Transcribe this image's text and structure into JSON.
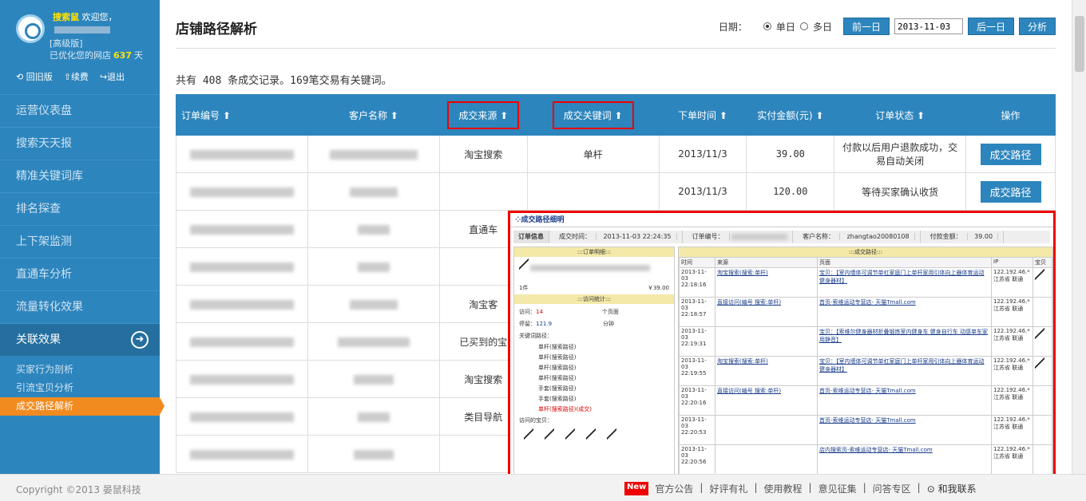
{
  "sidebar": {
    "username": "搜索鼠",
    "welcome": "欢迎您，",
    "edition": "[高级版]",
    "optimized_prefix": "已优化您的网店",
    "optimized_days": "637",
    "days_unit": "天",
    "links": [
      "回旧版",
      "续费",
      "退出"
    ],
    "items": [
      "运营仪表盘",
      "搜索天天报",
      "精准关键词库",
      "排名探查",
      "上下架监测",
      "直通车分析",
      "流量转化效果",
      "关联效果"
    ],
    "subitems": [
      "买家行为剖析",
      "引流宝贝分析",
      "成交路径解析"
    ]
  },
  "header": {
    "title": "店铺路径解析",
    "date_label": "日期：",
    "single_day": "单日",
    "multi_day": "多日",
    "prev_day": "前一日",
    "date_value": "2013-11-03",
    "next_day": "后一日",
    "analyze": "分析"
  },
  "summary": "共有 408 条成交记录。169笔交易有关键词。",
  "table": {
    "headers": [
      "订单编号",
      "客户名称",
      "成交来源",
      "成交关键词",
      "下单时间",
      "实付金额(元)",
      "订单状态",
      "操作"
    ],
    "rows": [
      {
        "source": "淘宝搜索",
        "keyword": "单杆",
        "time": "2013/11/3",
        "amount": "39.00",
        "status": "付款以后用户退款成功，交易自动关闭",
        "op": "成交路径"
      },
      {
        "source": "",
        "keyword": "",
        "time": "2013/11/3",
        "amount": "120.00",
        "status": "等待买家确认收货",
        "op": "成交路径"
      },
      {
        "source": "直通车",
        "keyword": "",
        "time": "",
        "amount": "",
        "status": "",
        "op": ""
      },
      {
        "source": "",
        "keyword": "",
        "time": "",
        "amount": "",
        "status": "",
        "op": ""
      },
      {
        "source": "淘宝客",
        "keyword": "",
        "time": "",
        "amount": "",
        "status": "",
        "op": ""
      },
      {
        "source": "已买到的宝",
        "keyword": "",
        "time": "",
        "amount": "",
        "status": "",
        "op": ""
      },
      {
        "source": "淘宝搜索",
        "keyword": "",
        "time": "",
        "amount": "",
        "status": "",
        "op": ""
      },
      {
        "source": "类目导航",
        "keyword": "",
        "time": "",
        "amount": "",
        "status": "",
        "op": ""
      },
      {
        "source": "",
        "keyword": "",
        "time": "",
        "amount": "",
        "status": "",
        "op": ""
      }
    ]
  },
  "overlay": {
    "title": "成交路径细明",
    "order_info": "订单信息",
    "deal_time_label": "成交时间：",
    "deal_time": "2013-11-03 22:24:35",
    "order_no_label": "订单编号：",
    "customer_label": "客户名称：",
    "customer": "zhangtao20080108",
    "paid_label": "付款金额：",
    "paid": "39.00",
    "detail_header": ":::订单明细:::",
    "qty": "1件",
    "price": "￥39.00",
    "visit_header": ":::访问统计:::",
    "visit_label": "访问：",
    "visit_count": "14",
    "visit_unit": "个页面",
    "stay_label": "停留：",
    "stay_value": "121.9",
    "stay_unit": "分钟",
    "keyword_path_label": "关键词路径：",
    "paths": [
      "单杆(搜索路径)",
      "单杆(搜索路径)",
      "单杆(搜索路径)",
      "单杆(搜索路径)",
      "手套(搜索路径)",
      "手套(搜索路径)",
      "单杆(搜索路径)(成交)"
    ],
    "visited_label": "访问的宝贝：",
    "path_header": ":::成交路径:::",
    "cols": [
      "时间",
      "来源",
      "页面",
      "IP",
      "宝贝"
    ],
    "rows": [
      {
        "time": "2013-11-03 22:18:16",
        "src": "淘宝搜索(搜索:单杆)",
        "page": "宝贝：【室内墙体可调节单杠家庭门上单杆家用引体向上器体育运动健身器材】",
        "ip": "122.192.46.* 江苏省 联通"
      },
      {
        "time": "2013-11-03 22:18:57",
        "src": "直接访问(编号 搜索:单杆)",
        "page": "首页-索维运动专营店- 天猫Tmall.com",
        "ip": "122.192.46.* 江苏省 联通"
      },
      {
        "time": "2013-11-03 22:19:31",
        "src": "",
        "page": "宝贝：【索维尔健身器材折叠锻炼室内健身车 健身自行车 动感单车家用静音】",
        "ip": "122.192.46.* 江苏省 联通"
      },
      {
        "time": "2013-11-03 22:19:55",
        "src": "淘宝搜索(搜索:单杆)",
        "page": "宝贝：【室内墙体可调节单杠家庭门上单杆家用引体向上器体育运动健身器材】",
        "ip": "122.192.46.* 江苏省 联通"
      },
      {
        "time": "2013-11-03 22:20:16",
        "src": "直接访问(编号 搜索:单杆)",
        "page": "首页-索维运动专营店- 天猫Tmall.com",
        "ip": "122.192.46.* 江苏省 联通"
      },
      {
        "time": "2013-11-03 22:20:53",
        "src": "",
        "page": "首页-索维运动专营店- 天猫Tmall.com",
        "ip": "122.192.46.* 江苏省 联通"
      },
      {
        "time": "2013-11-03 22:20:56",
        "src": "",
        "page": "店内搜索页-索维运动专营店- 天猫Tmall.com",
        "ip": "122.192.46.* 江苏省 联通"
      }
    ]
  },
  "footer": {
    "copyright": "Copyright ©2013 晏鼠科技",
    "new_tag": "New",
    "links": [
      "官方公告",
      "好评有礼",
      "使用教程",
      "意见征集",
      "问答专区"
    ],
    "contact": "和我联系"
  },
  "colors": {
    "primary": "#2d85bd",
    "accent": "#f28b1f",
    "highlight": "#e00000"
  }
}
